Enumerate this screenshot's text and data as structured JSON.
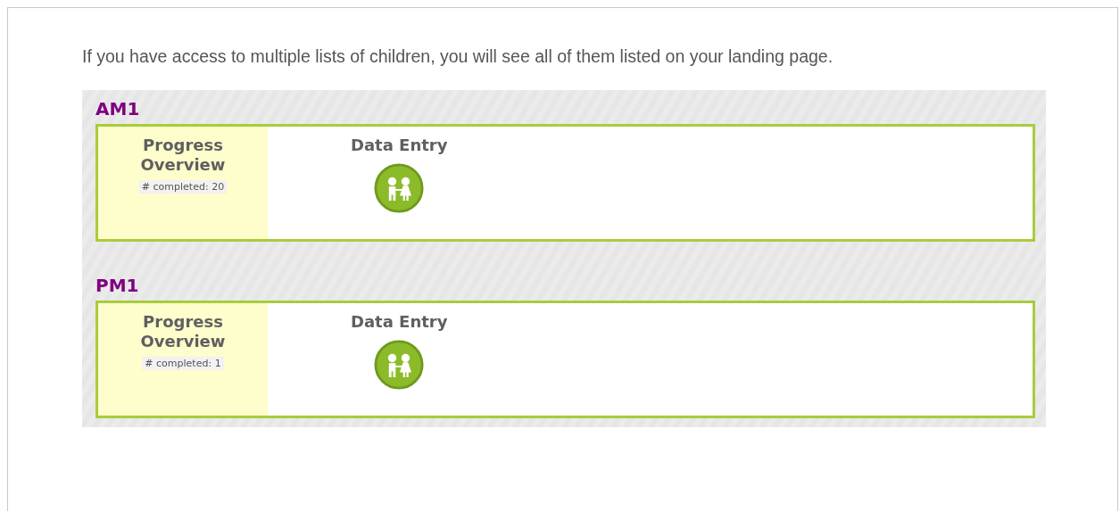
{
  "intro": "If you have access to multiple lists of children, you will see all of them listed on your landing page.",
  "lists": [
    {
      "name": "AM1",
      "progress_title": "Progress Overview",
      "completed": "# completed: 20",
      "data_entry_title": "Data Entry"
    },
    {
      "name": "PM1",
      "progress_title": "Progress Overview",
      "completed": "# completed: 1",
      "data_entry_title": "Data Entry"
    }
  ]
}
